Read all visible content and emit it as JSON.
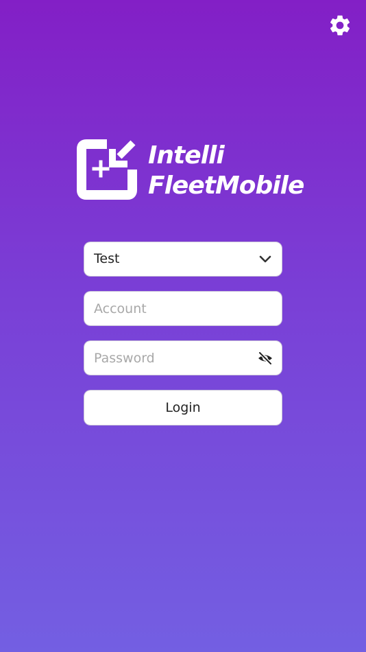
{
  "header": {
    "settings_icon": "gear-icon"
  },
  "logo": {
    "icon": "app-logo-icon",
    "line1": "Intelli",
    "line2": "FleetMobile",
    "color": "#ffffff"
  },
  "form": {
    "server_select": {
      "value": "Test",
      "icon": "chevron-down-icon"
    },
    "account": {
      "value": "",
      "placeholder": "Account"
    },
    "password": {
      "value": "",
      "placeholder": "Password",
      "icon": "eye-slash-icon"
    },
    "login_label": "Login"
  },
  "colors": {
    "background_top": "#831fc6",
    "background_bottom": "#735fe2",
    "field_background": "#ffffff",
    "field_border": "#c9c2d8",
    "text": "#222222",
    "placeholder": "#a8a8a8"
  }
}
